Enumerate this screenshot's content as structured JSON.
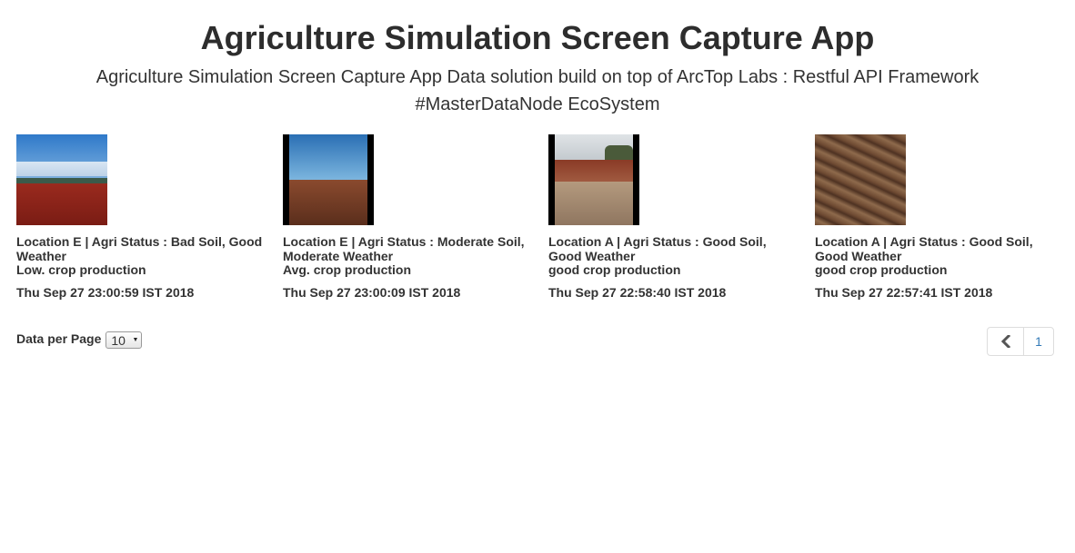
{
  "header": {
    "title": "Agriculture Simulation Screen Capture App",
    "subtitle_line1": "Agriculture Simulation Screen Capture App Data solution build on top of ArcTop Labs : Restful API Framework",
    "subtitle_line2": "#MasterDataNode EcoSystem"
  },
  "cards": [
    {
      "title_line1": "Location E | Agri Status : Bad Soil, Good",
      "title_line2": "Weather",
      "production": "Low. crop production",
      "timestamp": "Thu Sep 27 23:00:59 IST 2018"
    },
    {
      "title_line1": "Location E | Agri Status : Moderate Soil,",
      "title_line2": "Moderate Weather",
      "production": "Avg. crop production",
      "timestamp": "Thu Sep 27 23:00:09 IST 2018"
    },
    {
      "title_line1": "Location A | Agri Status : Good Soil,",
      "title_line2": "Good Weather",
      "production": "good crop production",
      "timestamp": "Thu Sep 27 22:58:40 IST 2018"
    },
    {
      "title_line1": "Location A | Agri Status : Good Soil,",
      "title_line2": "Good Weather",
      "production": "good crop production",
      "timestamp": "Thu Sep 27 22:57:41 IST 2018"
    }
  ],
  "footer": {
    "per_page_label": "Data per Page",
    "per_page_value": "10",
    "current_page": "1"
  },
  "colors": {
    "link": "#337ab7",
    "text": "#333333"
  }
}
